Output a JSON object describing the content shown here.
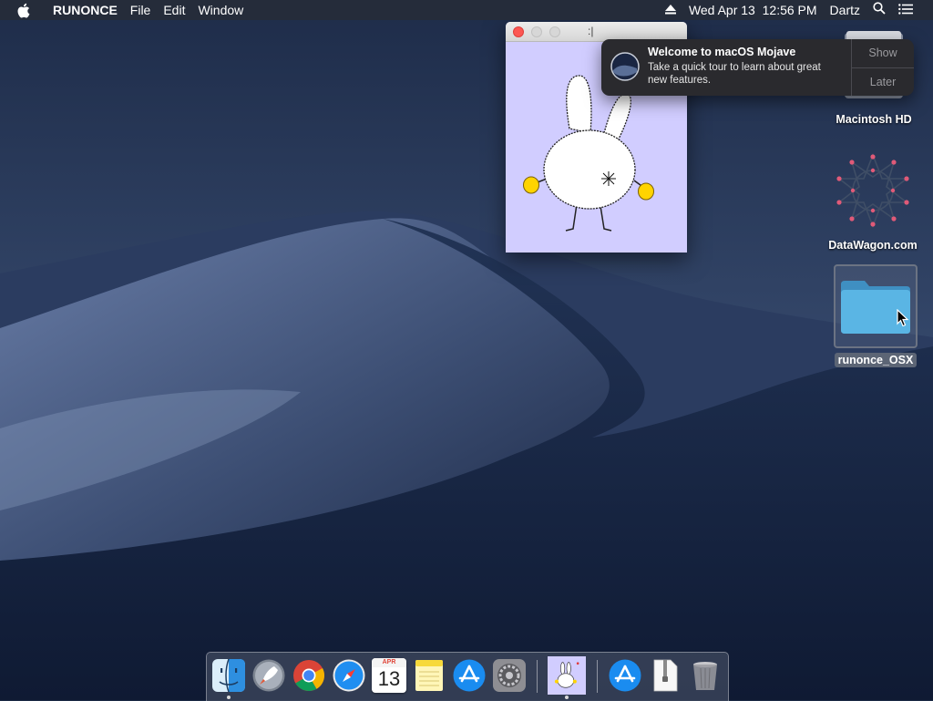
{
  "menubar": {
    "app_name": "RUNONCE",
    "menus": [
      "File",
      "Edit",
      "Window"
    ],
    "clock": "Wed Apr 13  12:56 PM",
    "user": "Dartz"
  },
  "window": {
    "title": ":|"
  },
  "notification": {
    "title": "Welcome to macOS Mojave",
    "body": "Take a quick tour to learn about great new features.",
    "show_label": "Show",
    "later_label": "Later"
  },
  "desktop": {
    "icons": [
      {
        "label": "Macintosh HD",
        "icon": "hard-drive-icon"
      },
      {
        "label": "DataWagon.com",
        "icon": "geometric-star-icon"
      },
      {
        "label": "runonce_OSX",
        "icon": "folder-icon",
        "selected": true
      }
    ]
  },
  "dock": {
    "apps": [
      {
        "name": "Finder",
        "icon": "finder-icon",
        "running": true
      },
      {
        "name": "Launchpad",
        "icon": "launchpad-icon"
      },
      {
        "name": "Google Chrome",
        "icon": "chrome-icon"
      },
      {
        "name": "Safari",
        "icon": "safari-icon"
      },
      {
        "name": "Calendar",
        "icon": "calendar-icon",
        "month": "APR",
        "day": "13"
      },
      {
        "name": "Notes",
        "icon": "notes-icon"
      },
      {
        "name": "App Store",
        "icon": "app-store-icon"
      },
      {
        "name": "System Preferences",
        "icon": "system-preferences-icon"
      },
      {
        "name": "runonce",
        "icon": "bunny-app-icon",
        "running": true
      },
      {
        "name": "App Store Downloads",
        "icon": "app-store-icon"
      },
      {
        "name": "Zip Archive",
        "icon": "zip-file-icon"
      },
      {
        "name": "Trash",
        "icon": "trash-icon"
      }
    ]
  },
  "colors": {
    "menubar": "#252c3a",
    "window_bg": "#d1cdff",
    "notification_bg": "#2a2a2e",
    "folder": "#4aa6d6"
  }
}
